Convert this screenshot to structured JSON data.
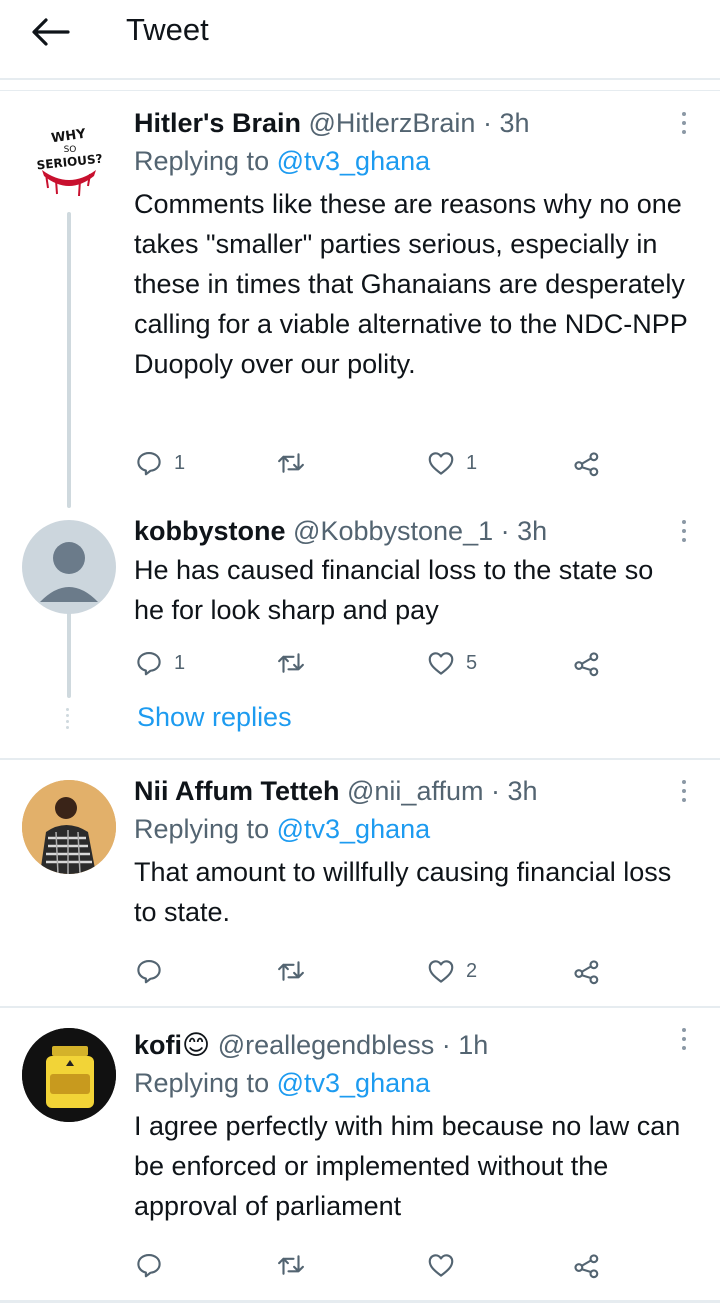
{
  "header": {
    "title": "Tweet"
  },
  "tweets": [
    {
      "name": "Hitler's Brain",
      "handle": "@HitlerzBrain",
      "sep": "·",
      "time": "3h",
      "reply_prefix": "Replying to",
      "reply_to": "@tv3_ghana",
      "text": "Comments like these are reasons why no one takes \"smaller\" parties serious, especially in these in times that Ghanaians are desperately calling for a viable alternative to the NDC-NPP Duopoly over our polity.",
      "replies": "1",
      "retweets": "",
      "likes": "1",
      "avatar_text": [
        "WHY",
        "SO",
        "SERIOUS?"
      ]
    },
    {
      "name": "kobbystone",
      "handle": "@Kobbystone_1",
      "sep": "·",
      "time": "3h",
      "text": "He has caused financial loss to the state so he for look sharp and pay",
      "replies": "1",
      "retweets": "",
      "likes": "5"
    },
    {
      "name": "Nii Affum Tetteh",
      "handle": "@nii_affum",
      "sep": "·",
      "time": "3h",
      "reply_prefix": "Replying to",
      "reply_to": "@tv3_ghana",
      "text": "That amount to willfully causing financial loss to state.",
      "replies": "",
      "retweets": "",
      "likes": "2"
    },
    {
      "name": "kofi",
      "emoji": "😊",
      "handle": "@reallegendbless",
      "sep": "·",
      "time": "1h",
      "reply_prefix": "Replying to",
      "reply_to": "@tv3_ghana",
      "text": "I agree perfectly with him because no law can be enforced or implemented without the approval of parliament",
      "replies": "",
      "retweets": "",
      "likes": ""
    }
  ],
  "show_replies": "Show replies",
  "colors": {
    "accent": "#1d9bf0",
    "muted": "#536471",
    "divider": "#e6ecf0"
  }
}
